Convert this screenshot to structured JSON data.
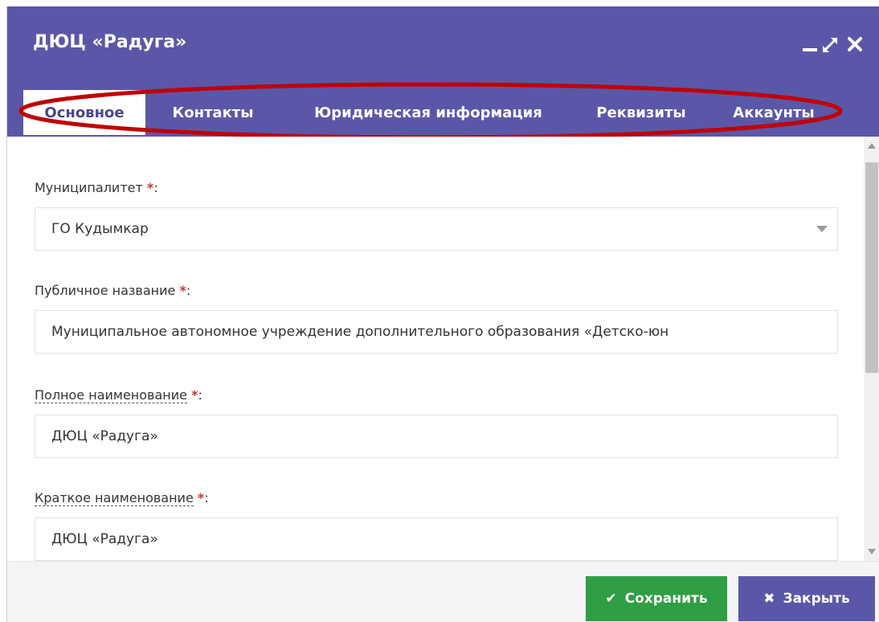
{
  "window": {
    "title": "ДЮЦ «Радуга»",
    "controls": [
      "minimize-icon",
      "expand-icon",
      "close-icon"
    ]
  },
  "tabs": [
    {
      "label": "Основное",
      "active": true
    },
    {
      "label": "Контакты",
      "active": false
    },
    {
      "label": "Юридическая информация",
      "active": false
    },
    {
      "label": "Реквизиты",
      "active": false
    },
    {
      "label": "Аккаунты",
      "active": false
    }
  ],
  "form": {
    "municipality": {
      "label": "Муниципалитет",
      "required_mark": "*",
      "suffix": ":",
      "value": "ГО Кудымкар"
    },
    "public_name": {
      "label": "Публичное название",
      "required_mark": "*",
      "suffix": ":",
      "value": "Муниципальное автономное учреждение дополнительного образования «Детско-юн"
    },
    "full_name": {
      "label": "Полное наименование",
      "required_mark": "*",
      "suffix": ":",
      "value": "ДЮЦ «Радуга»"
    },
    "short_name": {
      "label": "Краткое наименование",
      "required_mark": "*",
      "suffix": ":",
      "value": "ДЮЦ «Радуга»"
    }
  },
  "footer": {
    "save_label": "Сохранить",
    "close_label": "Закрыть"
  },
  "colors": {
    "header": "#5b57a8",
    "save": "#2f9e44",
    "close": "#5b57a8",
    "required": "#c0392b",
    "highlight_ellipse": "#c00000"
  }
}
